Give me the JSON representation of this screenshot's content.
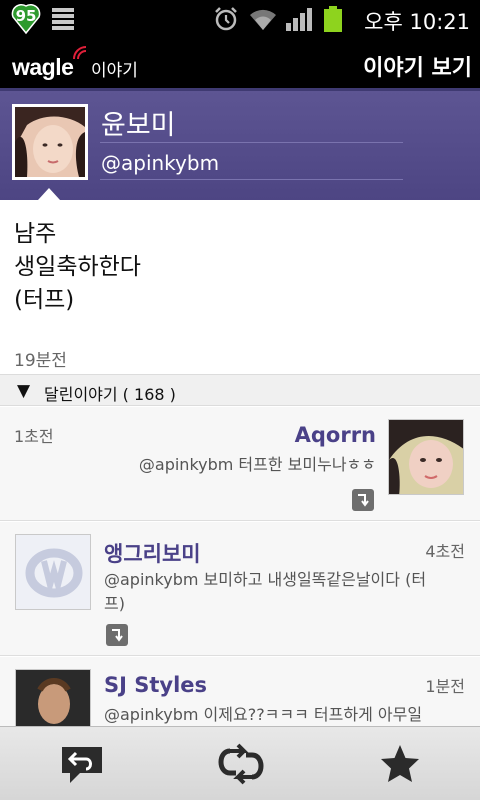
{
  "status_bar": {
    "badge_number": "95",
    "time": "오후 10:21",
    "icons": [
      "notification-badge-icon",
      "storage-bars-icon",
      "alarm-icon",
      "wifi-icon",
      "signal-icon",
      "battery-icon"
    ]
  },
  "app_bar": {
    "logo_text": "wagle",
    "logo_sub": "이야기",
    "title": "이야기 보기"
  },
  "profile": {
    "name": "윤보미",
    "handle": "@apinkybm"
  },
  "post": {
    "text": "남주\n생일축하한다\n(터프)",
    "time": "19분전"
  },
  "replies": {
    "label": "달린이야기 ( 168 )",
    "items": [
      {
        "name": "Aqorrn",
        "time": "1초전",
        "text": "@apinkybm 터프한 보미누나ㅎㅎ"
      },
      {
        "name": "앵그리보미",
        "time": "4초전",
        "text": "@apinkybm 보미하고 내생일똑같은날이다 (터프)"
      },
      {
        "name": "SJ Styles",
        "time": "1분전",
        "text": "@apinkybm 이제요??ㅋㅋㅋ 터프하게 아무일"
      }
    ]
  },
  "bottom_bar": {
    "buttons": [
      "reply-icon",
      "retweet-icon",
      "star-icon"
    ]
  },
  "colors": {
    "brand_purple": "#5d5593",
    "name_purple": "#4a4188",
    "battery_green": "#8ed31e",
    "logo_red": "#e0203a"
  }
}
